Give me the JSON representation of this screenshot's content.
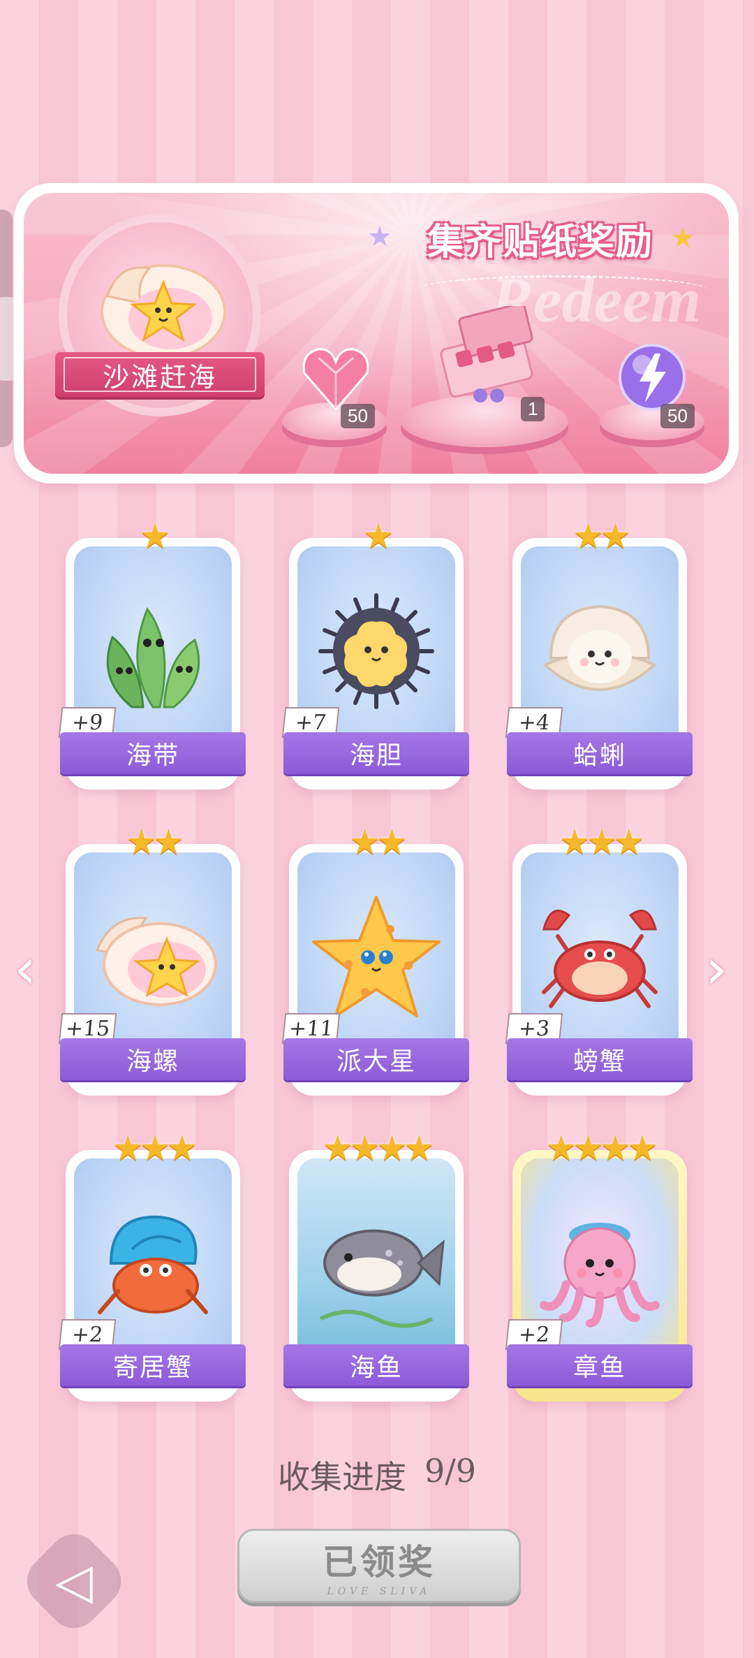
{
  "banner": {
    "title": "集齐贴纸奖励",
    "watermark": "Redeem",
    "emblem_name": "沙滩赶海",
    "rewards": [
      {
        "icon": "pink-heart-gem-icon",
        "count": "50"
      },
      {
        "icon": "gift-box-pack-icon",
        "count": "1"
      },
      {
        "icon": "purple-lightning-orb-icon",
        "count": "50"
      }
    ]
  },
  "stickers": [
    {
      "name": "海带",
      "stars": "★",
      "bonus": "+9",
      "icon": "kelp-icon"
    },
    {
      "name": "海胆",
      "stars": "★",
      "bonus": "+7",
      "icon": "sea-urchin-icon"
    },
    {
      "name": "蛤蜊",
      "stars": "★★",
      "bonus": "+4",
      "icon": "clam-icon"
    },
    {
      "name": "海螺",
      "stars": "★★",
      "bonus": "+15",
      "icon": "conch-icon"
    },
    {
      "name": "派大星",
      "stars": "★★",
      "bonus": "+11",
      "icon": "starfish-icon"
    },
    {
      "name": "螃蟹",
      "stars": "★★★",
      "bonus": "+3",
      "icon": "crab-icon"
    },
    {
      "name": "寄居蟹",
      "stars": "★★★",
      "bonus": "+2",
      "icon": "hermit-crab-icon"
    },
    {
      "name": "海鱼",
      "stars": "★★★★",
      "bonus": "",
      "icon": "fish-icon"
    },
    {
      "name": "章鱼",
      "stars": "★★★★",
      "bonus": "+2",
      "icon": "octopus-icon"
    }
  ],
  "progress": {
    "label": "收集进度",
    "value": "9/9"
  },
  "claim_button": {
    "label": "已领奖",
    "sub": "LOVE SLIVA"
  },
  "nav": {
    "prev": "‹",
    "next": "›",
    "back": "◁"
  },
  "colors": {
    "label_purple": "#9a68df",
    "star_gold": "#f5b82a",
    "banner_pink": "#f5a9bf"
  }
}
